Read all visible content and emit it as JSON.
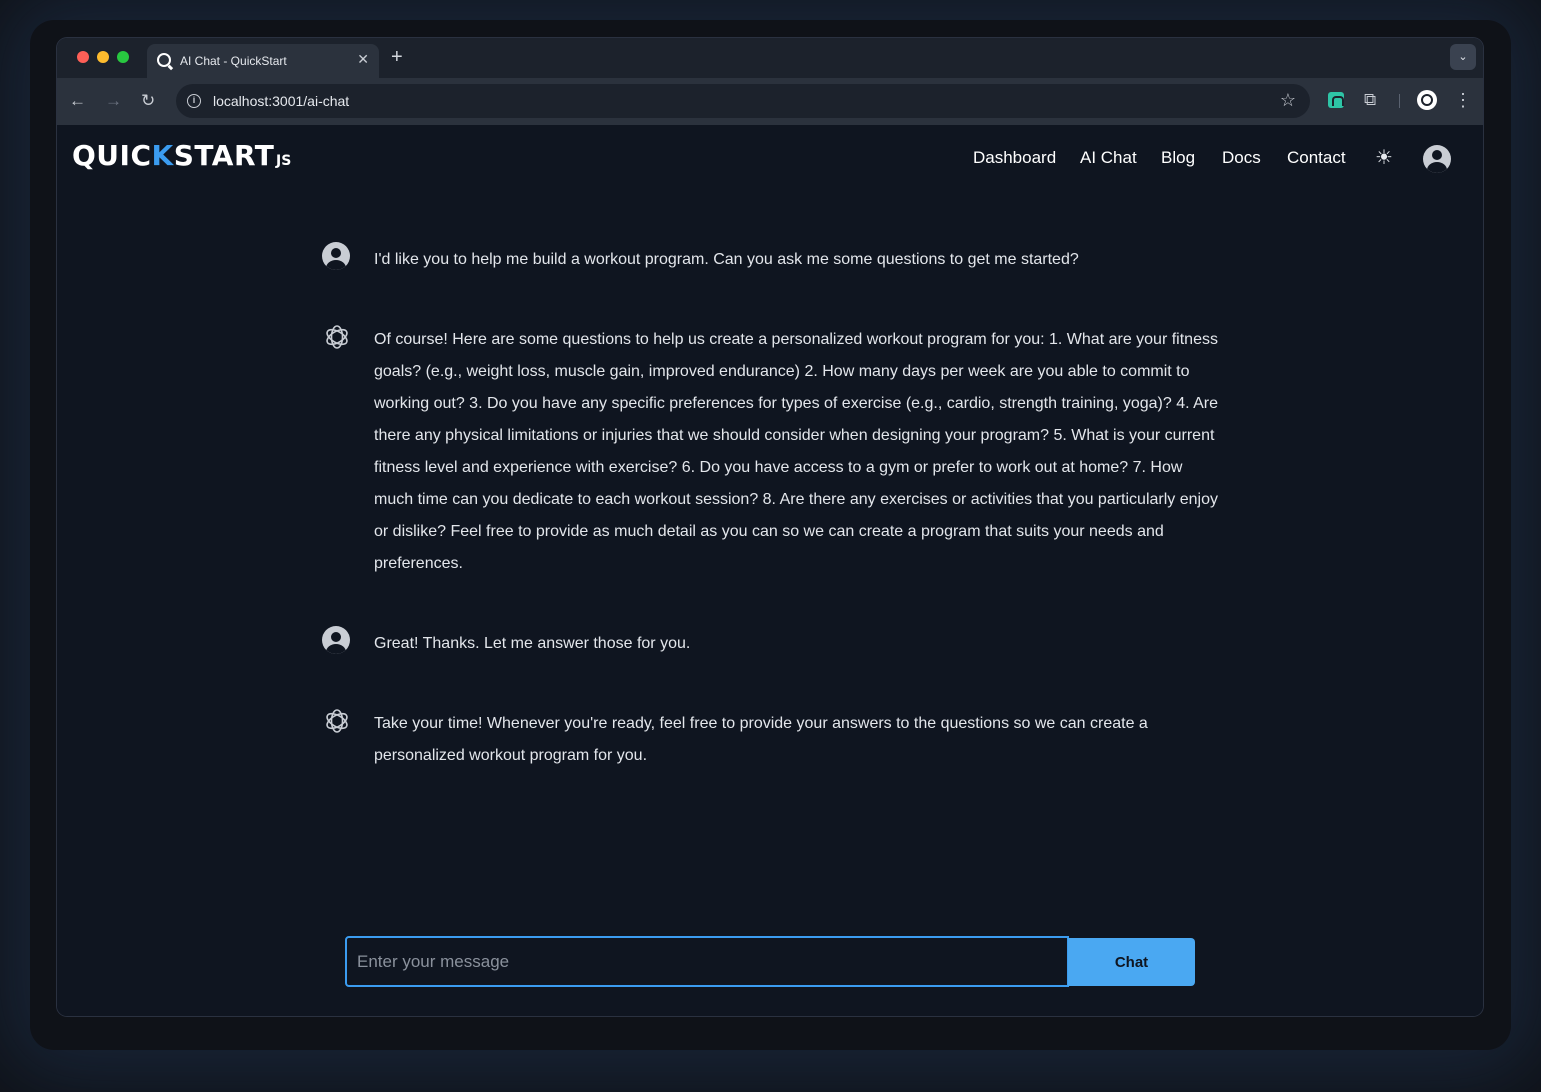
{
  "browser": {
    "tab_title": "AI Chat - QuickStart",
    "tab_close": "✕",
    "new_tab": "+",
    "tab_menu_icon": "chevron-down",
    "url": "localhost:3001/ai-chat"
  },
  "app": {
    "logo_pre": "QUIC",
    "logo_k": "K",
    "logo_post": "START",
    "logo_suffix": "JS",
    "nav": [
      {
        "label": "Dashboard"
      },
      {
        "label": "AI Chat"
      },
      {
        "label": "Blog"
      },
      {
        "label": "Docs"
      },
      {
        "label": "Contact"
      }
    ],
    "accent_color": "#3b9cf0"
  },
  "messages": [
    {
      "role": "user",
      "text": "I'd like you to help me build a workout program. Can you ask me some questions to get me started?"
    },
    {
      "role": "assistant",
      "text": "Of course! Here are some questions to help us create a personalized workout program for you: 1. What are your fitness goals? (e.g., weight loss, muscle gain, improved endurance) 2. How many days per week are you able to commit to working out? 3. Do you have any specific preferences for types of exercise (e.g., cardio, strength training, yoga)? 4. Are there any physical limitations or injuries that we should consider when designing your program? 5. What is your current fitness level and experience with exercise? 6. Do you have access to a gym or prefer to work out at home? 7. How much time can you dedicate to each workout session? 8. Are there any exercises or activities that you particularly enjoy or dislike? Feel free to provide as much detail as you can so we can create a program that suits your needs and preferences."
    },
    {
      "role": "user",
      "text": "Great! Thanks. Let me answer those for you."
    },
    {
      "role": "assistant",
      "text": "Take your time! Whenever you're ready, feel free to provide your answers to the questions so we can create a personalized workout program for you."
    }
  ],
  "composer": {
    "placeholder": "Enter your message",
    "value": "",
    "submit_label": "Chat"
  }
}
